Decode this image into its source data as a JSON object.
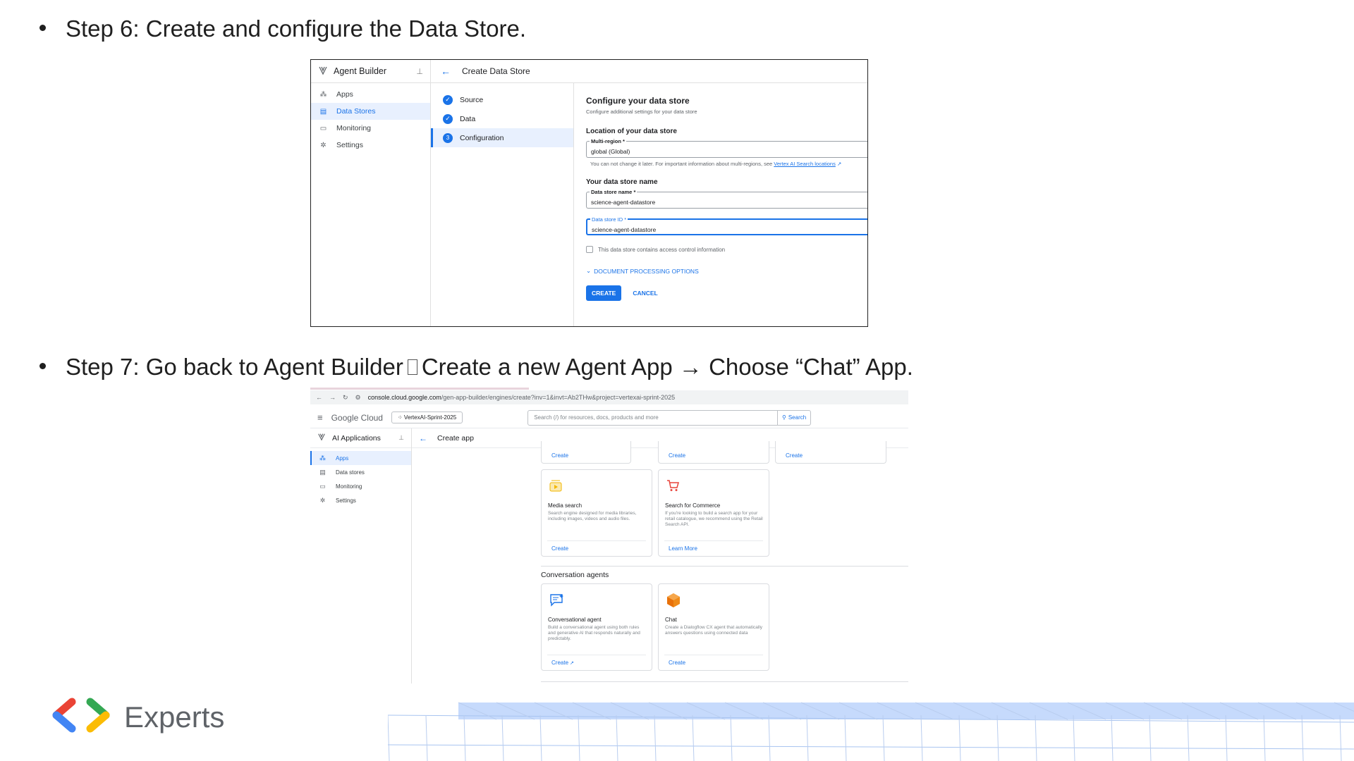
{
  "slide": {
    "step6": "Step 6: Create and configure the Data Store.",
    "step7_a": "Step 7: Go back to Agent Builder",
    "step7_b": "Create a new Agent App → Choose “Chat” App.",
    "logo_text": "Experts"
  },
  "shot1": {
    "app_name": "Agent Builder",
    "nav": [
      "Apps",
      "Data Stores",
      "Monitoring",
      "Settings"
    ],
    "page_title": "Create Data Store",
    "steps": [
      "Source",
      "Data",
      "Configuration"
    ],
    "step_number": "3",
    "form": {
      "title": "Configure your data store",
      "subtitle": "Configure additional settings for your data store",
      "location_heading": "Location of your data store",
      "region_label": "Multi-region *",
      "region_value": "global (Global)",
      "region_hint": "You can not change it later. For important information about multi-regions, see",
      "region_link": "Vertex AI Search locations",
      "name_heading": "Your data store name",
      "name_label": "Data store name *",
      "name_value": "science-agent-datastore",
      "id_label": "Data store ID *",
      "id_value": "science-agent-datastore",
      "acl_checkbox": "This data store contains access control information",
      "expander": "DOCUMENT PROCESSING OPTIONS",
      "create": "CREATE",
      "cancel": "CANCEL"
    }
  },
  "shot2": {
    "url_host": "console.cloud.google.com",
    "url_path": "/gen-app-builder/engines/create?inv=1&invt=Ab2THw&project=vertexai-sprint-2025",
    "brand": "Google Cloud",
    "project": "VertexAI-Sprint-2025",
    "search_placeholder": "Search (/) for resources, docs, products and more",
    "search_button": "Search",
    "app_name": "AI Applications",
    "nav": [
      "Apps",
      "Data stores",
      "Monitoring",
      "Settings"
    ],
    "page_title": "Create app",
    "top_cards": [
      "Create",
      "Create",
      "Create"
    ],
    "media": {
      "title": "Media search",
      "desc": "Search engine designed for media libraries, including images, videos and audio files.",
      "action": "Create"
    },
    "commerce": {
      "title": "Search for Commerce",
      "desc": "If you're looking to build a search app for your retail catalogue, we recommend using the Retail Search API.",
      "action": "Learn More"
    },
    "section": "Conversation agents",
    "conv": {
      "title": "Conversational agent",
      "desc": "Build a conversational agent using both rules and generative AI that responds naturally and predictably.",
      "action": "Create"
    },
    "chat": {
      "title": "Chat",
      "desc": "Create a Dialogflow CX agent that automatically answers questions using connected data",
      "action": "Create"
    }
  }
}
